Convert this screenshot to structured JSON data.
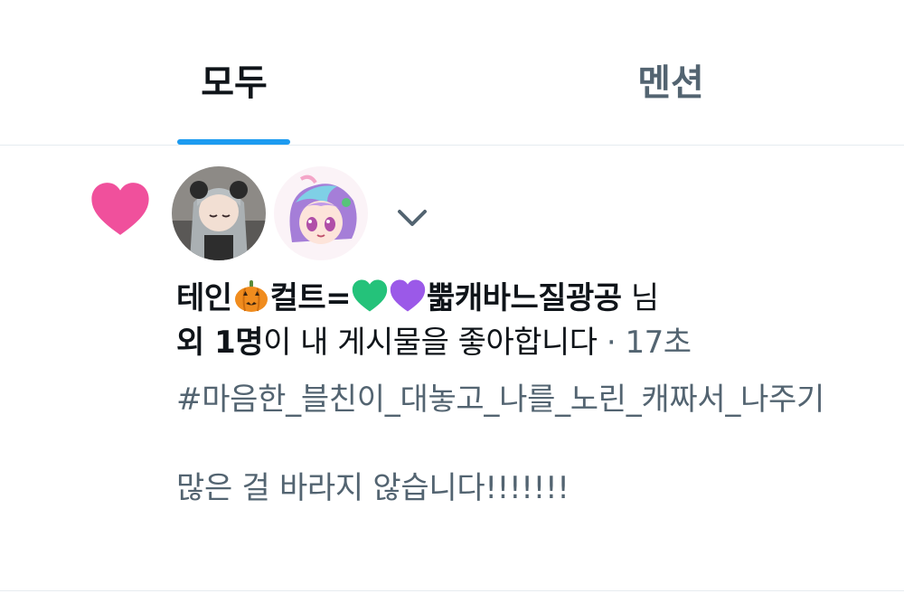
{
  "tabs": [
    {
      "label": "모두",
      "active": true
    },
    {
      "label": "멘션",
      "active": false
    }
  ],
  "colors": {
    "accent": "#1d9bf0",
    "heart": "#f0509c",
    "text_primary": "#0f1419",
    "text_secondary": "#536471"
  },
  "notification": {
    "icon": "heart-icon",
    "avatars": [
      "avatar",
      "avatar"
    ],
    "actor_name_part1": "테인",
    "actor_name_part2": "컬트=",
    "actor_name_part3": "뿗캐바느질광공",
    "actor_emojis": [
      "pumpkin-emoji",
      "green-heart-emoji",
      "purple-heart-emoji"
    ],
    "honorific": " 님",
    "others": "외 1명",
    "action": "이 내 게시물을 좋아합니다",
    "separator": " · ",
    "time": "17초",
    "tweet_text": "#마음한_블친이_대놓고_나를_노린_캐짜서_나주기\n\n많은 걸 바라지 않습니다!!!!!!!"
  }
}
